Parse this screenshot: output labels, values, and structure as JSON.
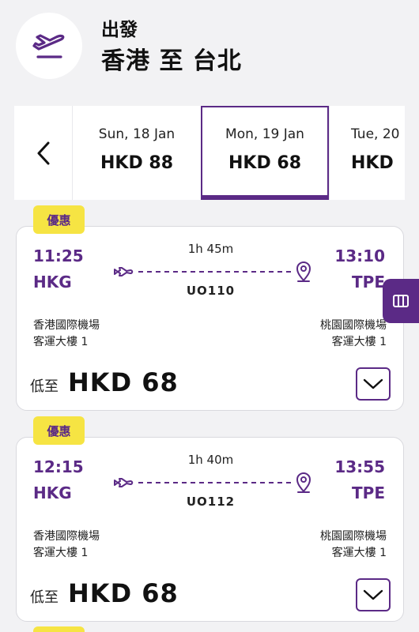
{
  "header": {
    "departure_label": "出發",
    "route_title": "香港 至 台北",
    "icon": "plane-departure-icon"
  },
  "dates": [
    {
      "day": "Sun, 18 Jan",
      "price": "HKD 88",
      "selected": false
    },
    {
      "day": "Mon, 19 Jan",
      "price": "HKD 68",
      "selected": true
    },
    {
      "day": "Tue, 20",
      "price": "HKD",
      "selected": false
    }
  ],
  "flights": [
    {
      "badge": "優惠",
      "dep_time": "11:25",
      "dep_code": "HKG",
      "arr_time": "13:10",
      "arr_code": "TPE",
      "duration": "1h 45m",
      "flight_no": "UO110",
      "dep_airport": "香港國際機場",
      "dep_terminal": "客運大樓 1",
      "arr_airport": "桃園國際機場",
      "arr_terminal": "客運大樓 1",
      "price_prefix": "低至",
      "price": "HKD 68"
    },
    {
      "badge": "優惠",
      "dep_time": "12:15",
      "dep_code": "HKG",
      "arr_time": "13:55",
      "arr_code": "TPE",
      "duration": "1h 40m",
      "flight_no": "UO112",
      "dep_airport": "香港國際機場",
      "dep_terminal": "客運大樓 1",
      "arr_airport": "桃園國際機場",
      "arr_terminal": "客運大樓 1",
      "price_prefix": "低至",
      "price": "HKD 68"
    }
  ],
  "colors": {
    "accent": "#5b2a86",
    "badge": "#f6e443",
    "background": "#f2f2f4"
  }
}
